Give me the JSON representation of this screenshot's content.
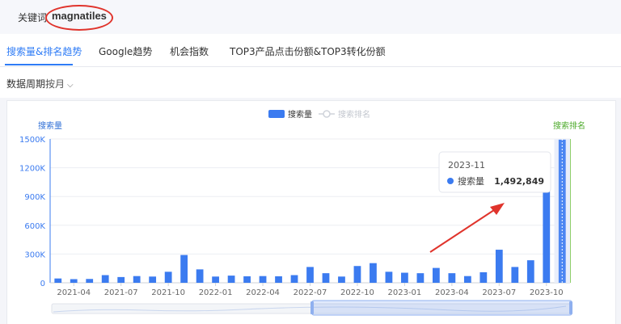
{
  "keyword": {
    "label": "关键词",
    "value": "magnatiles"
  },
  "tabs": [
    {
      "label": "搜索量&排名趋势",
      "active": true
    },
    {
      "label": "Google趋势",
      "active": false
    },
    {
      "label": "机会指数",
      "active": false
    },
    {
      "label": "TOP3产品点击份额&TOP3转化份额",
      "active": false
    }
  ],
  "period": {
    "label": "数据周期",
    "value": "按月"
  },
  "chart_data": {
    "type": "bar",
    "legend": [
      {
        "name": "搜索量",
        "color": "#3b7bf0",
        "active": true
      },
      {
        "name": "搜索排名",
        "color": "#cfd3da",
        "active": false
      }
    ],
    "y_left_label": "搜索量",
    "y_right_label": "搜索排名",
    "y_ticks": [
      "0",
      "300K",
      "600K",
      "900K",
      "1200K",
      "1500K"
    ],
    "ylim": [
      0,
      1500000
    ],
    "x_ticks": [
      "2021-04",
      "2021-07",
      "2021-10",
      "2022-01",
      "2022-04",
      "2022-07",
      "2022-10",
      "2023-01",
      "2023-04",
      "2023-07",
      "2023-10"
    ],
    "values": [
      45000,
      38000,
      40000,
      80000,
      60000,
      70000,
      65000,
      115000,
      290000,
      140000,
      65000,
      75000,
      68000,
      70000,
      68000,
      80000,
      165000,
      100000,
      65000,
      175000,
      205000,
      115000,
      105000,
      100000,
      155000,
      100000,
      70000,
      110000,
      345000,
      165000,
      235000,
      950000,
      1492849
    ],
    "highlight_index": 32,
    "bar_color": "#3b7bf0",
    "tooltip": {
      "title": "2023-11",
      "series": "搜索量",
      "value": "1,492,849"
    }
  }
}
